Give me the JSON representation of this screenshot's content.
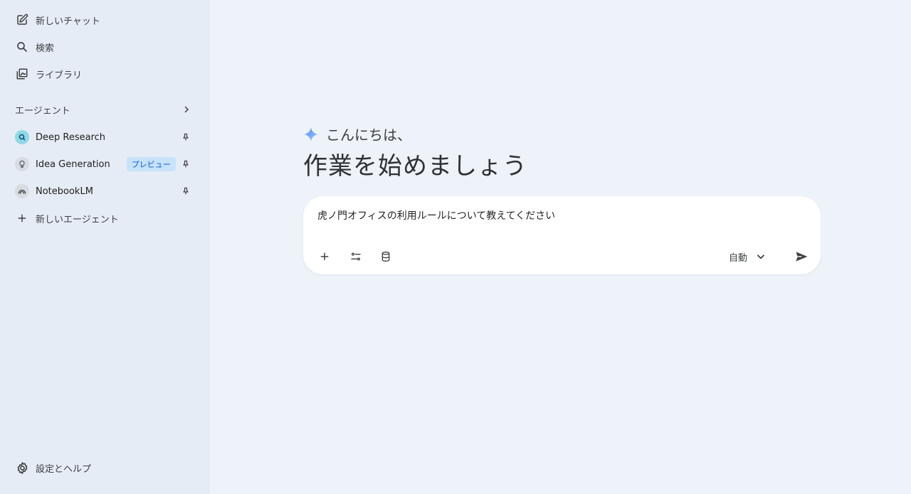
{
  "sidebar": {
    "new_chat": "新しいチャット",
    "search": "検索",
    "library": "ライブラリ",
    "agents_header": "エージェント",
    "agents": [
      {
        "name": "Deep Research",
        "badge": ""
      },
      {
        "name": "Idea Generation",
        "badge": "プレビュー"
      },
      {
        "name": "NotebookLM",
        "badge": ""
      }
    ],
    "new_agent": "新しいエージェント",
    "settings": "設定とヘルプ"
  },
  "main": {
    "greeting": "こんにちは、",
    "headline": "作業を始めましょう",
    "composer": {
      "query": "虎ノ門オフィスの利用ルールについて教えてください",
      "mode": "自動"
    }
  },
  "colors": {
    "sidebar_bg": "#e6ecf5",
    "main_bg": "#eef2f9",
    "badge_bg": "#c7e3fb",
    "badge_text": "#0b57d0",
    "accent": "#4285f4"
  },
  "icons": {
    "new_chat": "edit-square-icon",
    "search": "search-icon",
    "library": "library-icon",
    "agents_chevron": "chevron-right-icon",
    "pin": "pin-icon",
    "add": "plus-icon",
    "tools": "tune-icon",
    "data": "database-icon",
    "mode_chevron": "chevron-down-icon",
    "send": "send-icon",
    "settings": "gear-icon",
    "sparkle": "sparkle-icon"
  }
}
